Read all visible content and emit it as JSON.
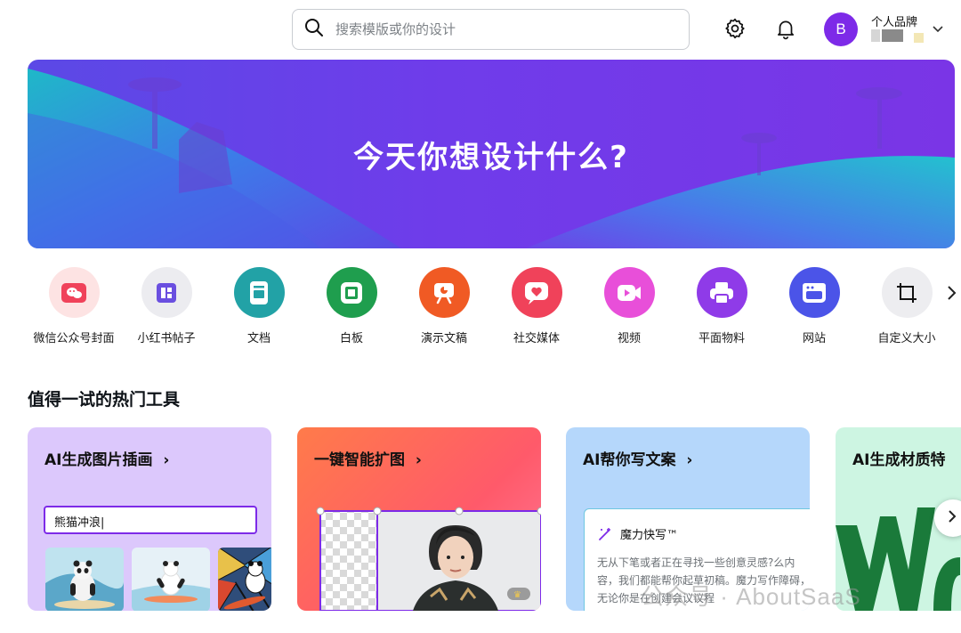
{
  "header": {
    "search_placeholder": "搜索模版或你的设计",
    "avatar_letter": "B",
    "team_name": "个人品牌"
  },
  "banner": {
    "title": "今天你想设计什么?"
  },
  "categories": [
    {
      "label": "微信公众号封面",
      "icon": "wechat-icon",
      "color": "#fde3e3"
    },
    {
      "label": "小红书帖子",
      "icon": "grid-post-icon",
      "color": "#ececf0"
    },
    {
      "label": "文档",
      "icon": "document-icon",
      "color": "#22a2a6"
    },
    {
      "label": "白板",
      "icon": "whiteboard-icon",
      "color": "#1f9e4e"
    },
    {
      "label": "演示文稿",
      "icon": "presentation-icon",
      "color": "#f05a24"
    },
    {
      "label": "社交媒体",
      "icon": "heart-icon",
      "color": "#f0425a"
    },
    {
      "label": "视频",
      "icon": "video-icon",
      "color": "#e84fd9"
    },
    {
      "label": "平面物料",
      "icon": "printer-icon",
      "color": "#8f3be8"
    },
    {
      "label": "网站",
      "icon": "website-icon",
      "color": "#4b54e8"
    },
    {
      "label": "自定义大小",
      "icon": "custom-size-icon",
      "color": "#ededf0"
    }
  ],
  "section": {
    "title": "值得一试的热门工具"
  },
  "tools": {
    "ai_image": {
      "title": "AI生成图片插画",
      "chevron": "›",
      "prompt": "熊猫冲浪"
    },
    "expand": {
      "title": "一键智能扩图",
      "chevron": "›"
    },
    "ai_write": {
      "title": "AI帮你写文案",
      "chevron": "›",
      "doc_title": "魔力快写™",
      "doc_body": "无从下笔或者正在寻找一些创意灵感?么内容，我们都能帮你起草初稿。魔力写作障碍，无论你是在创建会议议程"
    },
    "ai_texture": {
      "title": "AI生成材质特"
    }
  },
  "watermark": "公众号 · AboutSaaS"
}
